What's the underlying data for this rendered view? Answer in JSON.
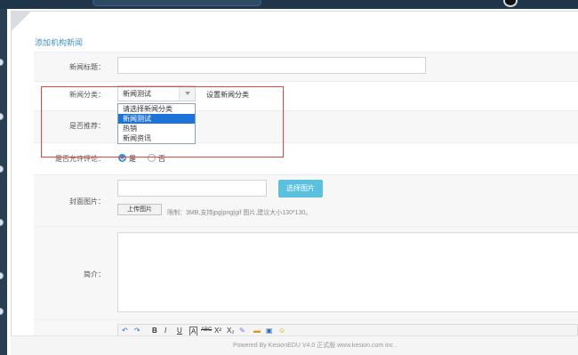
{
  "page": {
    "title": "添加机构新闻"
  },
  "form": {
    "news_title": {
      "label": "新闻标题：",
      "value": ""
    },
    "news_category": {
      "label": "新闻分类：",
      "selected": "新闻测试",
      "options": [
        "请选择新闻分类",
        "新闻测试",
        "热销",
        "新闻资讯"
      ],
      "setting_link": "设置新闻分类"
    },
    "recommend": {
      "label": "是否推荐："
    },
    "allow_comment": {
      "label": "是否允许评论：",
      "yes": "是",
      "no": "否",
      "value": "是"
    },
    "cover": {
      "label": "封面图片：",
      "choose_button": "选择图片",
      "upload_button": "上传图片",
      "hint": "限制：3MB,支持jpg|png|gif 图片,建议大小130*130。"
    },
    "summary": {
      "label": "简介："
    }
  },
  "editor_tools": [
    "↶",
    "↷",
    "B",
    "I",
    "U",
    "A",
    "ABC",
    "X²",
    "X₂",
    "✎",
    "▬",
    "▣",
    "☺"
  ],
  "footer": {
    "text": "Powered By KesionEDU V4.0 正式版 www.kesion.com inc ."
  },
  "colors": {
    "accent": "#5bc0de",
    "title": "#3f8fc0",
    "highlight": "#e04848",
    "selected": "#1e73d8"
  }
}
